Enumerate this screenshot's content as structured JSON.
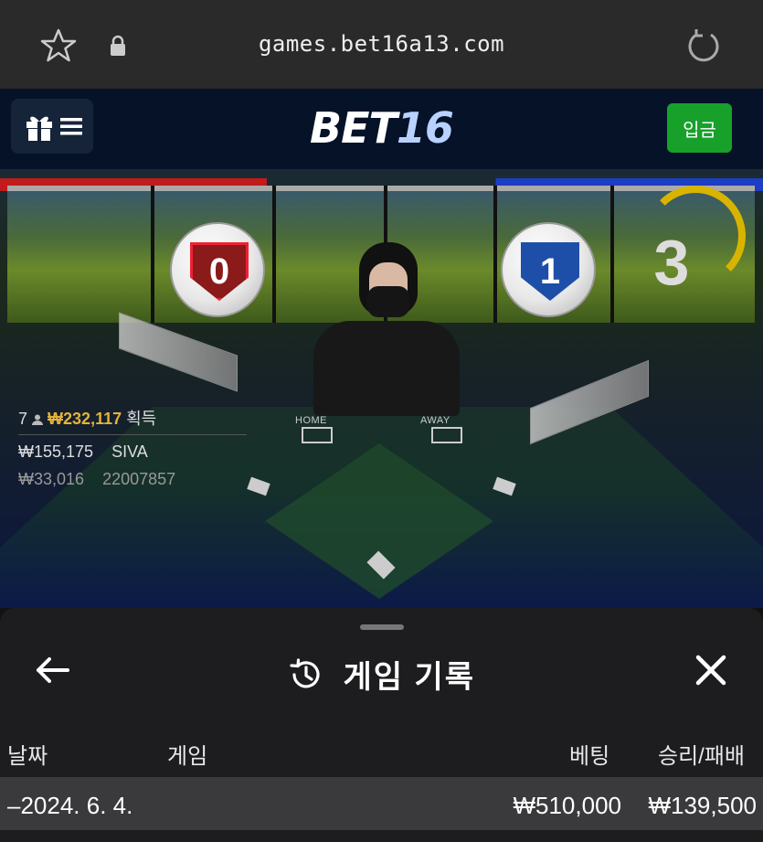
{
  "browser": {
    "url": "games.bet16a13.com",
    "icons": [
      "star-icon",
      "lock-icon",
      "reload-icon"
    ]
  },
  "header": {
    "logo_part1": "BET",
    "logo_part2": "16",
    "deposit_label": "입금",
    "icons": [
      "gift-icon",
      "menu-icon"
    ]
  },
  "game": {
    "home_score": "0",
    "away_score": "1",
    "countdown": "3",
    "home_label": "HOME",
    "away_label": "AWAY",
    "winners_count": "7",
    "winners_amount": "₩232,117",
    "winners_suffix": "획득",
    "bets": [
      {
        "amount": "₩155,175",
        "player": "SIVA"
      },
      {
        "amount": "₩33,016",
        "player": "22007857"
      }
    ]
  },
  "history_sheet": {
    "title": "게임 기록",
    "columns": {
      "date": "날짜",
      "game": "게임",
      "bet": "베팅",
      "win_loss": "승리/패배"
    },
    "rows": [
      {
        "date": "–2024. 6. 4.",
        "game": "",
        "bet": "₩510,000",
        "win_loss": "₩139,500"
      }
    ]
  },
  "colors": {
    "deposit_green": "#17a02a",
    "gold": "#e3b23c",
    "header_bg": "#051228"
  }
}
